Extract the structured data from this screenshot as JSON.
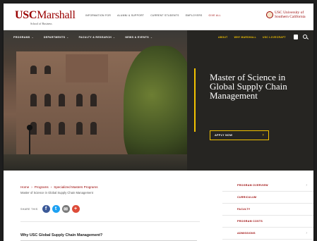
{
  "logo": {
    "brand_prefix": "USC",
    "brand_name": "Marshall",
    "subtitle": "School of Business"
  },
  "top_links": [
    "INFORMATION FOR",
    "ALUMNI & SUPPORT",
    "CURRENT STUDENTS",
    "EMPLOYERS",
    "GIVE ALL"
  ],
  "usc_logo": {
    "line1": "USC University of",
    "line2": "Southern California"
  },
  "nav": {
    "items": [
      "PROGRAMS",
      "DEPARTMENTS",
      "FACULTY & RESEARCH",
      "NEWS & EVENTS"
    ],
    "right_links": [
      "ABOUT",
      "WHY MARSHALL",
      "USC LOVECRAFT"
    ]
  },
  "hero": {
    "title": "Master of Science in Global Supply Chain Management",
    "cta": "APPLY NOW"
  },
  "breadcrumb": {
    "items": [
      "Home",
      "Programs",
      "Specialized Masters Programs"
    ],
    "current": "Master of Science in Global Supply Chain Management"
  },
  "share": {
    "label": "SHARE THIS"
  },
  "section_heading": "Why USC Global Supply Chain Management?",
  "sidebar": {
    "items": [
      "PROGRAM OVERVIEW",
      "CURRICULUM",
      "FACULTY",
      "PROGRAM COSTS",
      "ADMISSIONS"
    ]
  },
  "colors": {
    "brand": "#990000",
    "accent": "#f2c200"
  }
}
